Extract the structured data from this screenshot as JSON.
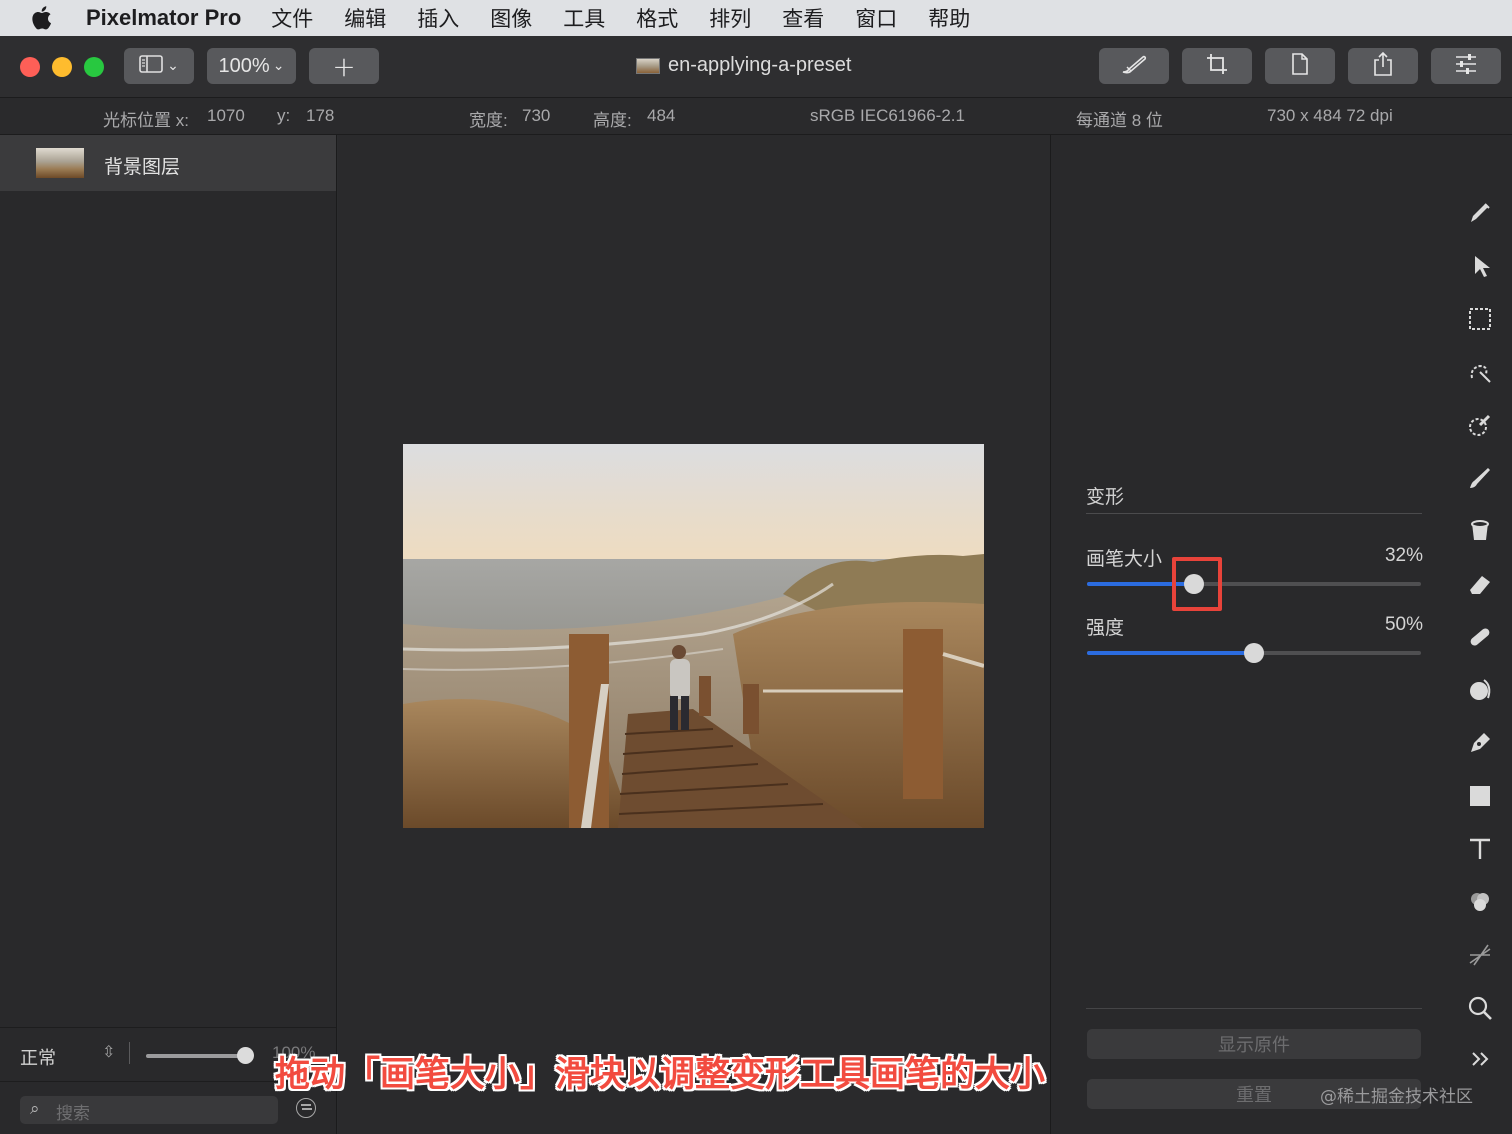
{
  "menubar": {
    "app_name": "Pixelmator Pro",
    "items": [
      "文件",
      "编辑",
      "插入",
      "图像",
      "工具",
      "格式",
      "排列",
      "查看",
      "窗口",
      "帮助"
    ]
  },
  "toolbar": {
    "zoom": "100%",
    "add_label": "+",
    "document_title": "en-applying-a-preset"
  },
  "infobar": {
    "cursor_x_label": "光标位置 x:",
    "cursor_x": "1070",
    "cursor_y_label": "y:",
    "cursor_y": "178",
    "width_label": "宽度:",
    "width": "730",
    "height_label": "高度:",
    "height": "484",
    "color_profile": "sRGB IEC61966-2.1",
    "bit_depth": "每通道 8 位",
    "dimensions": "730 x 484 72 dpi"
  },
  "layers": {
    "items": [
      {
        "name": "背景图层"
      }
    ],
    "blend_mode": "正常",
    "opacity_label": "100%",
    "opacity": 100,
    "search_placeholder": "搜索"
  },
  "inspector": {
    "section_title": "变形",
    "sliders": [
      {
        "label": "画笔大小",
        "value_text": "32%",
        "value": 32
      },
      {
        "label": "强度",
        "value_text": "50%",
        "value": 50
      }
    ],
    "show_original_label": "显示原件",
    "reset_label": "重置"
  },
  "tools": [
    "paint-style-icon",
    "arrange-icon",
    "selection-icon",
    "magic-select-icon",
    "color-select-icon",
    "paint-icon",
    "bucket-icon",
    "erase-icon",
    "retouch-icon",
    "distort-icon",
    "pen-icon",
    "shape-icon",
    "type-icon",
    "color-adjust-icon",
    "effects-icon",
    "zoom-icon",
    "more-icon"
  ],
  "caption": "拖动「画笔大小」滑块以调整变形工具画笔的大小",
  "watermark": "@稀土掘金技术社区",
  "colors": {
    "accent": "#2b6ce0",
    "highlight": "#e8433a",
    "caption": "#f24b3f"
  }
}
